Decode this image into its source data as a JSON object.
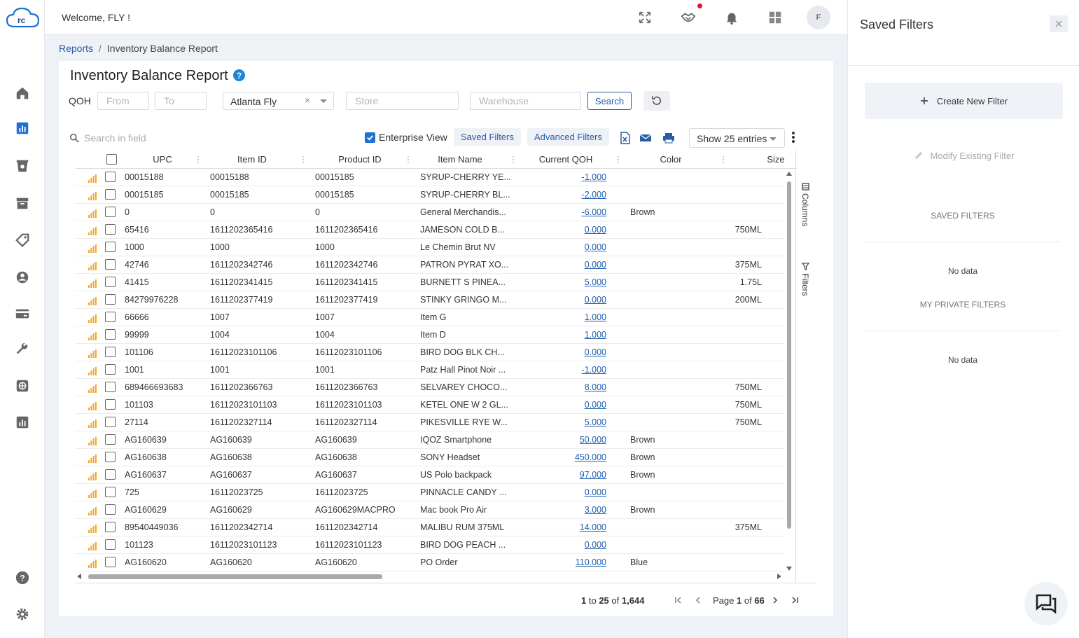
{
  "header": {
    "welcome": "Welcome, FLY !",
    "avatar_initial": "F",
    "logo_text": "rc"
  },
  "nav": {
    "icons": [
      "home-icon",
      "reports-icon",
      "inventory-icon",
      "archive-icon",
      "tag-icon",
      "user-icon",
      "card-icon",
      "wrench-icon",
      "globe-icon",
      "chart-icon",
      "help-icon",
      "settings-icon"
    ]
  },
  "breadcrumb": {
    "root": "Reports",
    "separator": "/",
    "current": "Inventory Balance Report"
  },
  "filters": {
    "title": "Inventory Balance Report",
    "help": "?",
    "qoh_label": "QOH",
    "from_placeholder": "From",
    "to_placeholder": "To",
    "location_value": "Atlanta Fly",
    "clear": "×",
    "store_placeholder": "Store",
    "warehouse_placeholder": "Warehouse",
    "search_label": "Search"
  },
  "toolbar": {
    "search_placeholder": "Search in field",
    "enterprise_view": "Enterprise View",
    "saved_filters": "Saved Filters",
    "advanced_filters": "Advanced Filters",
    "show_entries": "Show 25 entries"
  },
  "table": {
    "columns": [
      "UPC",
      "Item ID",
      "Product ID",
      "Item Name",
      "Current QOH",
      "Color",
      "Size"
    ],
    "rows": [
      [
        "00015188",
        "00015188",
        "00015185",
        "SYRUP-CHERRY YE...",
        "-1.000",
        "",
        ""
      ],
      [
        "00015185",
        "00015185",
        "00015185",
        "SYRUP-CHERRY BL...",
        "-2.000",
        "",
        ""
      ],
      [
        "0",
        "0",
        "0",
        "General Merchandis...",
        "-6.000",
        "Brown",
        ""
      ],
      [
        "65416",
        "1611202365416",
        "1611202365416",
        "JAMESON COLD B...",
        "0.000",
        "",
        "750ML"
      ],
      [
        "1000",
        "1000",
        "1000",
        "Le Chemin Brut NV",
        "0.000",
        "",
        ""
      ],
      [
        "42746",
        "1611202342746",
        "1611202342746",
        "PATRON PYRAT XO...",
        "0.000",
        "",
        "375ML"
      ],
      [
        "41415",
        "1611202341415",
        "1611202341415",
        "BURNETT S PINEA...",
        "5.000",
        "",
        "1.75L"
      ],
      [
        "84279976228",
        "1611202377419",
        "1611202377419",
        "STINKY GRINGO M...",
        "0.000",
        "",
        "200ML"
      ],
      [
        "66666",
        "1007",
        "1007",
        "Item G",
        "1.000",
        "",
        ""
      ],
      [
        "99999",
        "1004",
        "1004",
        "Item D",
        "1.000",
        "",
        ""
      ],
      [
        "101106",
        "16112023101106",
        "16112023101106",
        "BIRD DOG BLK CH...",
        "0.000",
        "",
        ""
      ],
      [
        "1001",
        "1001",
        "1001",
        "Patz Hall Pinot Noir ...",
        "-1.000",
        "",
        ""
      ],
      [
        "689466693683",
        "1611202366763",
        "1611202366763",
        "SELVAREY CHOCO...",
        "8.000",
        "",
        "750ML"
      ],
      [
        "101103",
        "16112023101103",
        "16112023101103",
        "KETEL ONE W 2 GL...",
        "0.000",
        "",
        "750ML"
      ],
      [
        "27114",
        "1611202327114",
        "1611202327114",
        "PIKESVILLE RYE W...",
        "5.000",
        "",
        "750ML"
      ],
      [
        "AG160639",
        "AG160639",
        "AG160639",
        "IQOZ Smartphone",
        "50.000",
        "Brown",
        ""
      ],
      [
        "AG160638",
        "AG160638",
        "AG160638",
        "SONY Headset",
        "450.000",
        "Brown",
        ""
      ],
      [
        "AG160637",
        "AG160637",
        "AG160637",
        "US Polo backpack",
        "97.000",
        "Brown",
        ""
      ],
      [
        "725",
        "16112023725",
        "16112023725",
        "PINNACLE CANDY ...",
        "0.000",
        "",
        ""
      ],
      [
        "AG160629",
        "AG160629",
        "AG160629MACPRO",
        "Mac book Pro Air",
        "3.000",
        "Brown",
        ""
      ],
      [
        "89540449036",
        "1611202342714",
        "1611202342714",
        "MALIBU RUM 375ML",
        "14.000",
        "",
        "375ML"
      ],
      [
        "101123",
        "16112023101123",
        "16112023101123",
        "BIRD DOG PEACH ...",
        "0.000",
        "",
        ""
      ],
      [
        "AG160620",
        "AG160620",
        "AG160620",
        "PO Order",
        "110.000",
        "Blue",
        ""
      ]
    ]
  },
  "side_tabs": {
    "columns": "Columns",
    "filters": "Filters"
  },
  "pager": {
    "from": "1",
    "to_word": "to",
    "to": "25",
    "of_word": "of",
    "total": "1,644",
    "page_word": "Page",
    "page": "1",
    "pages": "66"
  },
  "panel": {
    "title": "Saved Filters",
    "create": "Create New Filter",
    "modify": "Modify Existing Filter",
    "saved_header": "SAVED FILTERS",
    "saved_empty": "No data",
    "private_header": "MY PRIVATE FILTERS",
    "private_empty": "No data"
  },
  "colors": {
    "accent": "#2a5ca8",
    "link": "#1f5fae",
    "bars": "#f5a623",
    "notification": "#e0143c"
  }
}
